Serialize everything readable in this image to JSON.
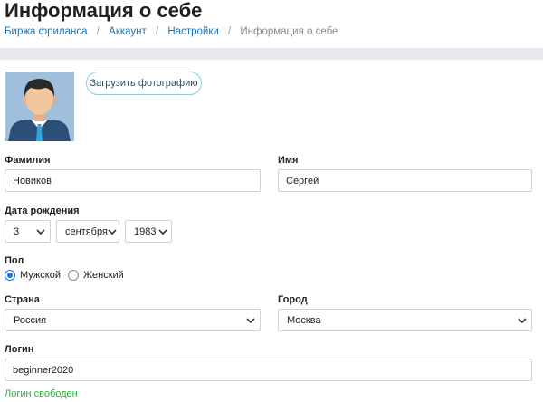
{
  "page_title": "Информация о себе",
  "breadcrumb": {
    "items": [
      "Биржа фриланса",
      "Аккаунт",
      "Настройки"
    ],
    "current": "Информация о себе",
    "separator": "/"
  },
  "avatar": {
    "icon": "user-avatar-icon",
    "bg_color": "#9fbfdc"
  },
  "upload_button": "Загрузить фотографию",
  "last_name": {
    "label": "Фамилия",
    "value": "Новиков"
  },
  "first_name": {
    "label": "Имя",
    "value": "Сергей"
  },
  "birth_date": {
    "label": "Дата рождения",
    "day": "3",
    "month": "сентября",
    "year": "1983"
  },
  "gender": {
    "label": "Пол",
    "options": [
      {
        "label": "Мужской",
        "checked": true
      },
      {
        "label": "Женский",
        "checked": false
      }
    ]
  },
  "country": {
    "label": "Страна",
    "value": "Россия"
  },
  "city": {
    "label": "Город",
    "value": "Москва"
  },
  "login": {
    "label": "Логин",
    "value": "beginner2020",
    "status": "Логин свободен",
    "status_color": "#2eac3c"
  },
  "colors": {
    "link": "#1a73b8",
    "accent": "#1a73e8",
    "band": "#e8e9ec"
  }
}
